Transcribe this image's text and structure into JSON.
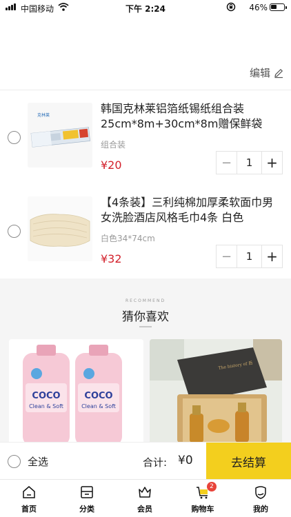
{
  "status_bar": {
    "carrier": "中国移动",
    "time": "下午 2:24",
    "battery": "46%"
  },
  "header": {
    "edit_label": "编辑"
  },
  "cart": {
    "items": [
      {
        "title": "韩国克林莱铝箔纸锡纸组合装25cm*8m+30cm*8m赠保鲜袋",
        "spec": "组合装",
        "price": "¥20",
        "quantity": "1",
        "thumb_icon": "foil-product-image"
      },
      {
        "title": "【4条装】三利纯棉加厚柔软面巾男女洗脸酒店风格毛巾4条 白色",
        "spec": "白色34*74cm",
        "price": "¥32",
        "quantity": "1",
        "thumb_icon": "towel-product-image"
      }
    ]
  },
  "stepper": {
    "minus": "−",
    "plus": "+"
  },
  "recommend": {
    "subtitle": "RECOMMEND",
    "title": "猜你喜欢"
  },
  "recommend_cards": [
    {
      "product_label": "COCO",
      "product_sub": "Clean & Soft"
    },
    {
      "product_label": "The history of 后"
    }
  ],
  "checkout": {
    "select_all": "全选",
    "total_label": "合计:",
    "total_value": "¥0",
    "settle_label": "去结算"
  },
  "tabbar": {
    "items": [
      {
        "label": "首页",
        "icon": "home-icon"
      },
      {
        "label": "分类",
        "icon": "category-icon"
      },
      {
        "label": "会员",
        "icon": "crown-icon"
      },
      {
        "label": "购物车",
        "icon": "cart-icon",
        "badge": "2"
      },
      {
        "label": "我的",
        "icon": "profile-icon"
      }
    ]
  },
  "colors": {
    "accent": "#f3cf1e",
    "price": "#d3202b",
    "badge": "#e8443a"
  }
}
